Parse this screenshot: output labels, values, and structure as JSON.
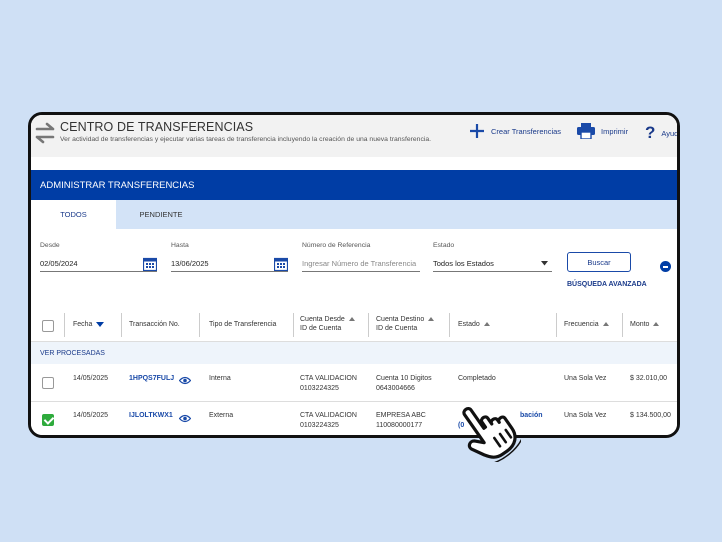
{
  "header": {
    "title": "CENTRO DE TRANSFERENCIAS",
    "subtitle": "Ver actividad de transferencias y ejecutar varias tareas de transferencia incluyendo la creación de una nueva transferencia.",
    "create_label": "Crear Transferencias",
    "print_label": "Imprimir",
    "help_label": "Ayud"
  },
  "banner": {
    "title": "ADMINISTRAR TRANSFERENCIAS"
  },
  "tabs": [
    {
      "label": "TODOS"
    },
    {
      "label": "PENDIENTE"
    }
  ],
  "filters": {
    "desde": {
      "label": "Desde",
      "value": "02/05/2024"
    },
    "hasta": {
      "label": "Hasta",
      "value": "13/06/2025"
    },
    "referencia": {
      "label": "Número de Referencia",
      "placeholder": "Ingresar Número de Transferencia"
    },
    "estado": {
      "label": "Estado",
      "value": "Todos los Estados"
    },
    "search_label": "Buscar",
    "advanced_label": "BÚSQUEDA AVANZADA"
  },
  "table": {
    "headers": {
      "fecha": "Fecha",
      "transaccion": "Transacción No.",
      "tipo": "Tipo de Transferencia",
      "desde_1": "Cuenta Desde",
      "desde_2": "ID de Cuenta",
      "destino_1": "Cuenta Destino",
      "destino_2": "ID de Cuenta",
      "estado": "Estado",
      "frecuencia": "Frecuencia",
      "monto": "Monto"
    },
    "group_label": "VER PROCESADAS",
    "rows": [
      {
        "fecha": "14/05/2025",
        "transaccion": "1HPQS7FULJ",
        "tipo": "Interna",
        "desde_nombre": "CTA VALIDACION",
        "desde_id": "0103224325",
        "destino_nombre": "Cuenta 10 Digitos",
        "destino_id": "0643004666",
        "estado": "Completado",
        "frecuencia": "Una Sola Vez",
        "monto": "$ 32.010,00",
        "checked": false
      },
      {
        "fecha": "14/05/2025",
        "transaccion": "IJLOLTKWX1",
        "tipo": "Externa",
        "desde_nombre": "CTA VALIDACION",
        "desde_id": "0103224325",
        "destino_nombre": "EMPRESA ABC",
        "destino_id": "110080000177",
        "estado": "bación",
        "estado_pre": "(0",
        "frecuencia": "Una Sola Vez",
        "monto": "$ 134.500,00",
        "checked": true
      }
    ]
  },
  "colors": {
    "brand_blue": "#003da5",
    "tab_bar": "#d3e3f7",
    "check_green": "#2eab3c",
    "background": "#cfe0f5"
  },
  "icons": [
    "swap-arrows-icon",
    "plus-icon",
    "printer-icon",
    "help-icon",
    "calendar-icon",
    "chevron-down-icon",
    "minus-circle-icon",
    "eye-icon",
    "hand-pointer-icon"
  ]
}
